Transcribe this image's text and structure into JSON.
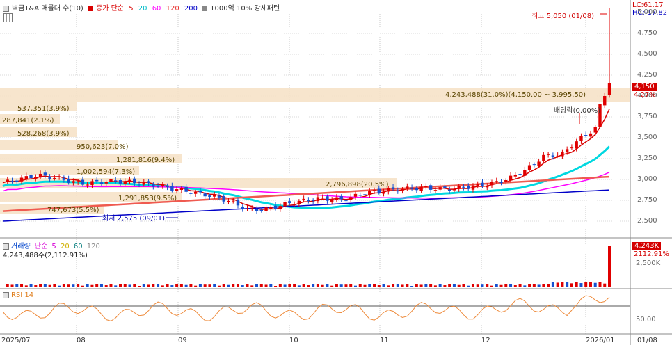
{
  "legend": {
    "main_title": "벽금T&A 매물대 수(10)",
    "ma_label": "종가 단순",
    "ma_periods": [
      "5",
      "20",
      "60",
      "120",
      "200"
    ],
    "ma_colors": [
      "#d90000",
      "#00cfd8",
      "#ff00ff",
      "#e8302c",
      "#0000c8"
    ],
    "pattern_label": "1000억 10% 강세패턴"
  },
  "price_axis": {
    "ticks": [
      "5,000",
      "4,750",
      "4,500",
      "4,250",
      "4,000",
      "3,750",
      "3,500",
      "3,250",
      "3,000",
      "2,750",
      "2,500"
    ],
    "lc_label": "LC:61.17",
    "hc_label": "HC:-17.82",
    "current_price": "4,150",
    "current_change": "4.27%"
  },
  "annotations": {
    "high": "최고 5,050 (01/08)",
    "low": "최저 2,575 (09/01)",
    "dividend": "배당락(0.00%)"
  },
  "volume_profile": [
    {
      "label": "4,243,488(31.0%)(4,150.00 ~ 3,995.50)"
    },
    {
      "label": "537,351(3.9%)"
    },
    {
      "label": "287,841(2.1%)"
    },
    {
      "label": "528,268(3.9%)"
    },
    {
      "label": "950,623(7.0%)"
    },
    {
      "label": "1,281,816(9.4%)"
    },
    {
      "label": "1,002,594(7.3%)"
    },
    {
      "label": "2,796,898(20.5%)"
    },
    {
      "label": "1,291,853(9.5%)"
    },
    {
      "label": "747,673(5.5%)"
    }
  ],
  "volume_pane": {
    "title": "거래량",
    "ma_label": "단순",
    "ma_periods": [
      "5",
      "20",
      "60",
      "120"
    ],
    "ma_colors": [
      "#d600d6",
      "#e0c000",
      "#007a7a",
      "#888888"
    ],
    "value_text": "4,243,488주(2,112.91%)",
    "axis_tick": "2,500K",
    "current_badge": "4,243K",
    "current_pct": "2112.91%"
  },
  "rsi_pane": {
    "title": "RSI 14",
    "axis_tick": "50.00"
  },
  "x_axis": {
    "labels": [
      "2025/07",
      "08",
      "09",
      "10",
      "11",
      "12",
      "2026/01",
      "01/08"
    ]
  }
}
